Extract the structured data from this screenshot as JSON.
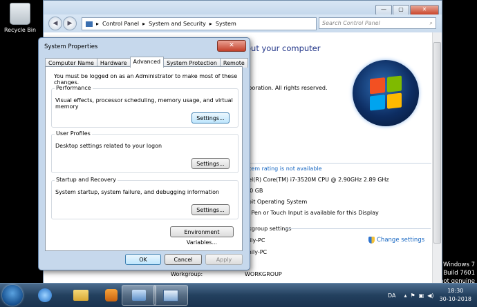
{
  "desktop": {
    "recycle_label": "Recycle Bin",
    "watermark": [
      "Windows 7",
      "Build 7601",
      "not genuine"
    ]
  },
  "control_panel": {
    "address": [
      "Control Panel",
      "System and Security",
      "System"
    ],
    "search_placeholder": "Search Control Panel",
    "heading": "out your computer",
    "copyright": "rporation. All rights reserved.",
    "rating_link": "stem rating is not available",
    "processor": "tel(R) Core(TM) i7-3520M CPU @ 2.90GHz   2.89 GHz",
    "memory": "50 GB",
    "system_type": "-bit Operating System",
    "pen_touch": "o Pen or Touch Input is available for this Display",
    "section_workgroup": "rkgroup settings",
    "computer_name": "nily-PC",
    "full_name": "mily-PC",
    "change_settings": "Change settings",
    "workgroup_label": "Workgroup:",
    "workgroup_value": "WORKGROUP"
  },
  "dialog": {
    "title": "System Properties",
    "close": "✕",
    "tabs": [
      "Computer Name",
      "Hardware",
      "Advanced",
      "System Protection",
      "Remote"
    ],
    "active_tab": "Advanced",
    "admin_note": "You must be logged on as an Administrator to make most of these changes.",
    "groups": [
      {
        "title": "Performance",
        "desc": "Visual effects, processor scheduling, memory usage, and virtual memory",
        "button": "Settings..."
      },
      {
        "title": "User Profiles",
        "desc": "Desktop settings related to your logon",
        "button": "Settings..."
      },
      {
        "title": "Startup and Recovery",
        "desc": "System startup, system failure, and debugging information",
        "button": "Settings..."
      }
    ],
    "env_button": "Environment Variables...",
    "ok": "OK",
    "cancel": "Cancel",
    "apply": "Apply"
  },
  "taskbar": {
    "lang": "DA",
    "time": "18:30",
    "date": "30-10-2018"
  },
  "colors": {
    "accent": "#1566c2",
    "heading": "#1e3287"
  }
}
